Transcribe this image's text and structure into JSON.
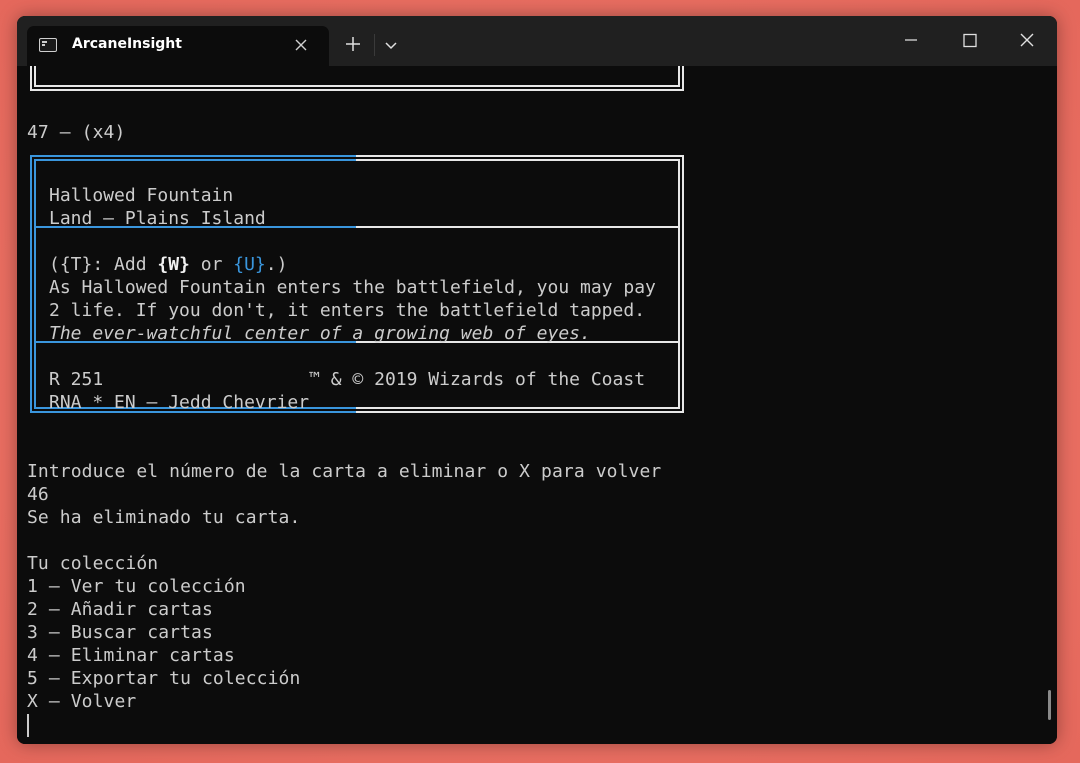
{
  "window": {
    "tab_title": "ArcaneInsight",
    "close_tab_label": "✕",
    "new_tab_label": "+"
  },
  "terminal": {
    "card_header": "47 – (x4)",
    "card": {
      "name": "Hallowed Fountain",
      "type_line": "Land — Plains Island",
      "rules_prefix": "({T}: Add ",
      "mana_w": "{W}",
      "rules_or": " or ",
      "mana_u": "{U}",
      "rules_suffix": ".)",
      "rules_line2": "As Hallowed Fountain enters the battlefield, you may pay",
      "rules_line3": "2 life. If you don't, it enters the battlefield tapped.",
      "flavor": "The ever-watchful center of a growing web of eyes.",
      "collector_line": "R 251                   ™ & © 2019 Wizards of the Coast",
      "set_line": "RNA * EN — Jedd Chevrier"
    },
    "prompt": "Introduce el número de la carta a eliminar o X para volver",
    "input_value": "46",
    "result_msg": "Se ha eliminado tu carta.",
    "menu_title": "Tu colección",
    "menu_items": [
      "1 – Ver tu colección",
      "2 – Añadir cartas",
      "3 – Buscar cartas",
      "4 – Eliminar cartas",
      "5 – Exportar tu colección",
      "X – Volver"
    ]
  },
  "colors": {
    "accent_blue": "#3a96dd",
    "text": "#cccccc",
    "background": "#0c0c0c"
  }
}
